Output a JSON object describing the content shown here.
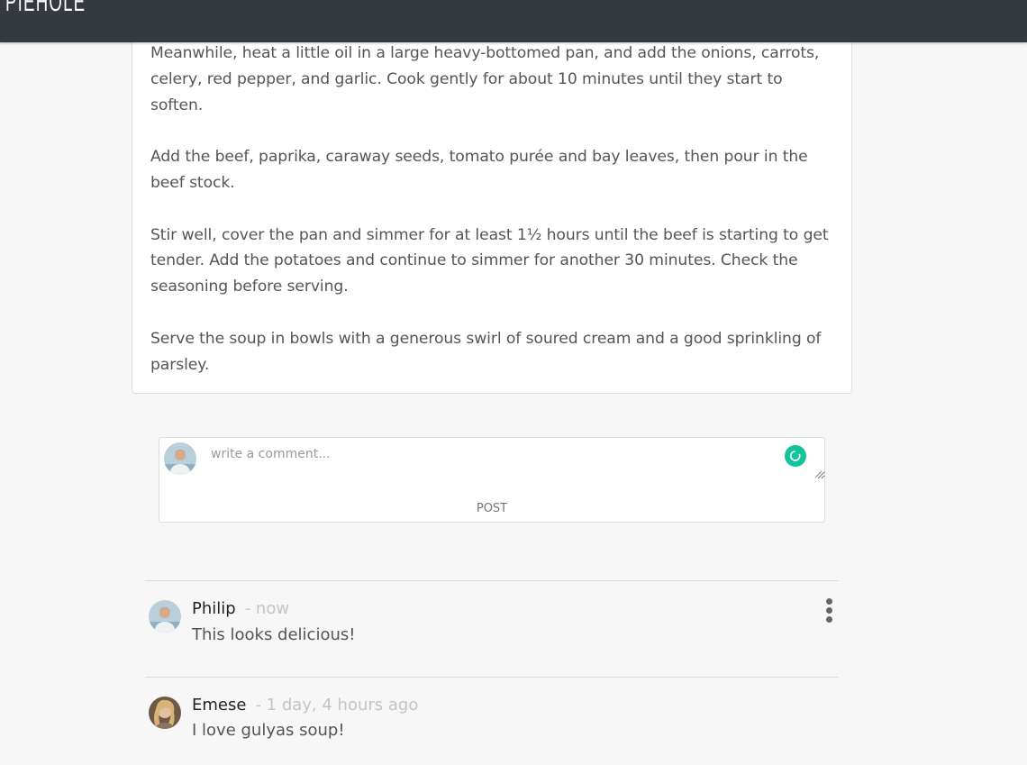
{
  "header": {
    "brand": "PIEHOLE"
  },
  "recipe": {
    "steps": [
      "Meanwhile, heat a little oil in a large heavy-bottomed pan, and add the onions, carrots, celery, red pepper, and garlic. Cook gently for about 10 minutes until they start to soften.",
      "Add the beef, paprika, caraway seeds, tomato purée and bay leaves, then pour in the beef stock.",
      "Stir well, cover the pan and simmer for at least 1½ hours until the beef is starting to get tender. Add the potatoes and continue to simmer for another 30 minutes. Check the seasoning before serving.",
      "Serve the soup in bowls with a generous swirl of soured cream and a good sprinkling of parsley."
    ]
  },
  "comment_form": {
    "placeholder": "write a comment...",
    "value": "",
    "post_label": "POST"
  },
  "comments": [
    {
      "author": "Philip",
      "time": "- now",
      "text": "This looks delicious!"
    },
    {
      "author": "Emese",
      "time": "- 1 day, 4 hours ago",
      "text": "I love gulyas soup!"
    }
  ],
  "icons": {
    "grammar_badge": "grammar-check-icon",
    "menu": "kebab-menu-icon"
  },
  "colors": {
    "header_bg": "#343a40",
    "accent_green": "#15c39a",
    "timestamp": "#c4c4c4"
  }
}
